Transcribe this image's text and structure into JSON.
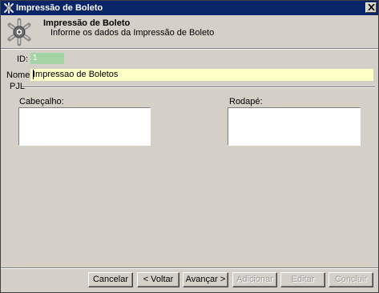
{
  "window": {
    "title": "Impressão de Boleto"
  },
  "header": {
    "title": "Impressão de Boleto",
    "subtitle": "Informe os dados da Impressão de Boleto"
  },
  "form": {
    "id_label": "ID:",
    "id_value": "1",
    "nome_label": "Nome:",
    "nome_value": "Impressao de Boletos",
    "group_label": "PJL",
    "cabecalho_label": "Cabeçalho:",
    "rodape_label": "Rodapé:"
  },
  "buttons": {
    "cancelar": "Cancelar",
    "voltar": "< Voltar",
    "avancar": "Avançar >",
    "adicionar": "Adicionar",
    "editar": "Editar",
    "concluir": "Concluir"
  },
  "colors": {
    "titlebar": "#0a246a",
    "id_field": "#a4d3a4",
    "nome_field": "#ffffc8",
    "face": "#d4d0c8"
  }
}
